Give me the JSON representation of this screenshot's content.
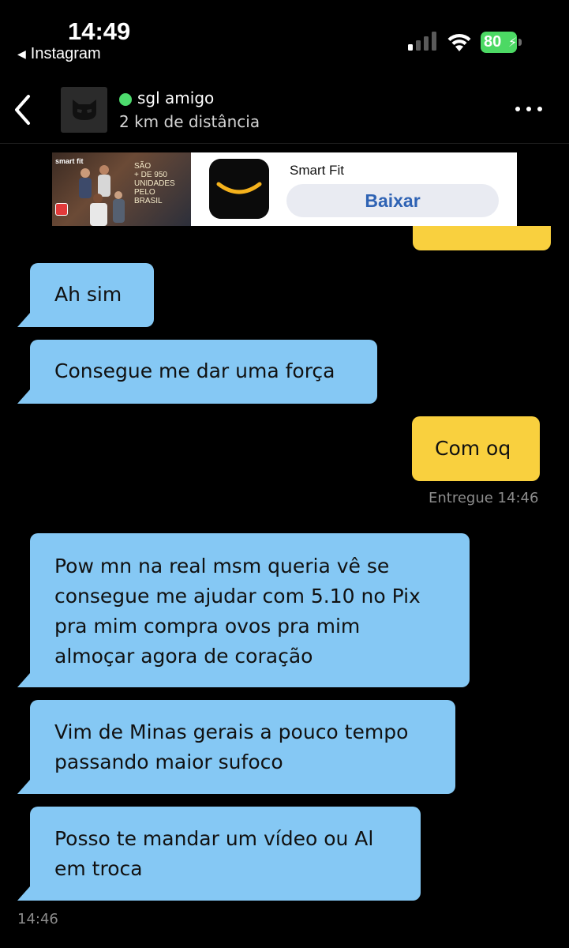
{
  "status_bar": {
    "time": "14:49",
    "back_app": "Instagram",
    "battery": "80",
    "signal_bars_active": 1
  },
  "header": {
    "name": "sgl amigo",
    "distance": "2 km de distância",
    "online": true,
    "online_color": "#4ddb6d"
  },
  "ad": {
    "brand": "smart fit",
    "tagline": "SÃO\n+ DE 950\nUNIDADES\nPELO\nBRASIL",
    "app_name": "Smart Fit",
    "cta": "Baixar"
  },
  "messages": [
    {
      "from": "them",
      "text": "Ah sim"
    },
    {
      "from": "them",
      "text": "Consegue me dar uma força"
    },
    {
      "from": "me",
      "text": "Com oq",
      "status": "Entregue 14:46"
    },
    {
      "from": "them",
      "text": "Pow mn na real msm queria vê se\nconsegue me ajudar com 5.10 no Pix\npra mim compra ovos pra mim\nalmoçar agora de coração"
    },
    {
      "from": "them",
      "text": "Vim de Minas gerais a pouco tempo\npassando maior sufoco"
    },
    {
      "from": "them",
      "text": "Posso te mandar um vídeo ou Al\nem troca"
    }
  ],
  "last_timestamp": "14:46",
  "colors": {
    "incoming_bubble": "#85c8f4",
    "outgoing_bubble": "#f9d03e",
    "background": "#000000"
  }
}
